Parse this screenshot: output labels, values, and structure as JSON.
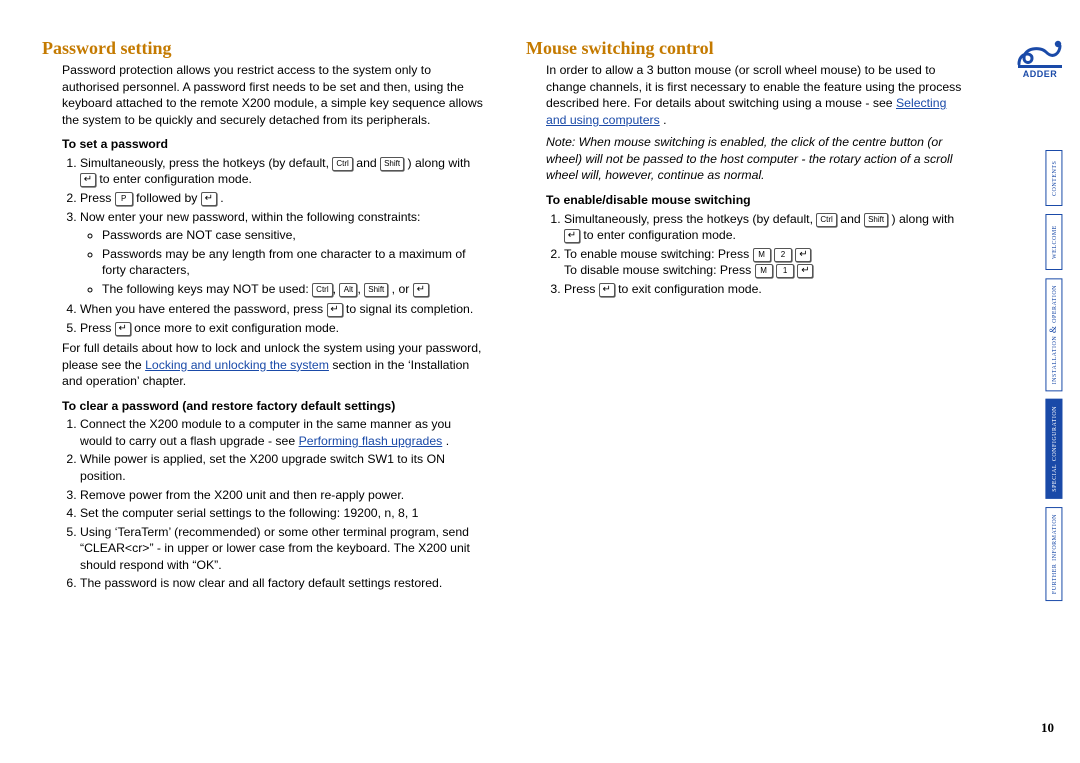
{
  "brand": "ADDER",
  "page_number": "10",
  "side_tabs": [
    {
      "key": "contents",
      "label": "contents",
      "active": false
    },
    {
      "key": "welcome",
      "label": "welcome",
      "active": false
    },
    {
      "key": "install",
      "label": "installation\n& operation",
      "active": false
    },
    {
      "key": "special",
      "label": "special\nconfiguration",
      "active": true
    },
    {
      "key": "further",
      "label": "further\ninformation",
      "active": false
    }
  ],
  "keys": {
    "ctrl": "Ctrl",
    "alt": "Alt",
    "shift": "Shift",
    "enter": "↵",
    "P": "P",
    "M": "M",
    "1": "1",
    "2": "2"
  },
  "left": {
    "title": "Password setting",
    "lead": "Password protection allows you restrict access to the system only to authorised personnel. A password first needs to be set and then, using the keyboard attached to the remote X200 module, a simple key sequence allows the system to be quickly and securely detached from its peripherals.",
    "set_heading": "To set a password",
    "set_step1_a": "Simultaneously, press the hotkeys (by default, ",
    "set_step1_b": " and ",
    "set_step1_c": ") along with ",
    "set_step1_d": " to enter configuration mode.",
    "set_step2_a": "Press ",
    "set_step2_b": " followed by ",
    "set_step2_c": ".",
    "set_step3": "Now enter your new password, within the following constraints:",
    "set_bullets": [
      "Passwords are NOT case sensitive,",
      "Passwords may be any length from one character to a maximum of forty characters,"
    ],
    "set_bullet3_a": "The following keys may NOT be used: ",
    "set_bullet3_or": ", or ",
    "set_step4_a": "When you have entered the password, press ",
    "set_step4_b": " to signal its completion.",
    "set_step5_a": "Press ",
    "set_step5_b": " once more to exit configuration mode.",
    "after_a": "For full details about how to lock and unlock the system using your password, please see the ",
    "after_link": "Locking and unlocking the system",
    "after_b": " section in the ‘Installation and operation’ chapter.",
    "clear_heading": "To clear a password (and restore factory default settings)",
    "clear_step1_a": "Connect the X200 module to a computer in the same manner as you would to carry out a flash upgrade - see ",
    "clear_step1_link": "Performing flash upgrades",
    "clear_step1_b": ".",
    "clear_step2": "While power is applied, set the X200 upgrade switch SW1 to its ON position.",
    "clear_step3": "Remove power from the X200 unit and then re-apply power.",
    "clear_step4": "Set the computer serial settings to the following: 19200, n, 8, 1",
    "clear_step5": "Using ‘TeraTerm’ (recommended) or some other terminal program, send “CLEAR<cr>” - in upper or lower case from the keyboard. The X200 unit should respond with “OK”.",
    "clear_step6": "The password is now clear and all factory default settings restored."
  },
  "right": {
    "title": "Mouse switching control",
    "lead_a": "In order to allow a 3 button mouse (or scroll wheel mouse) to be used to change channels, it is first necessary to enable the feature using the process described here. For details about switching using a mouse - see ",
    "lead_link": "Selecting and using computers",
    "lead_b": ".",
    "note": "Note: When mouse switching is enabled, the click of the centre button (or wheel) will not be passed to the host computer - the rotary action of a scroll wheel will, however, continue as normal.",
    "en_heading": "To enable/disable mouse switching",
    "en_step1_a": "Simultaneously, press the hotkeys (by default, ",
    "en_step1_b": " and ",
    "en_step1_c": ") along with ",
    "en_step1_d": " to enter configuration mode.",
    "en_step2_a": "To enable mouse switching: Press ",
    "en_step2_b": "To disable mouse switching: Press ",
    "en_step3_a": "Press ",
    "en_step3_b": " to exit configuration mode."
  }
}
